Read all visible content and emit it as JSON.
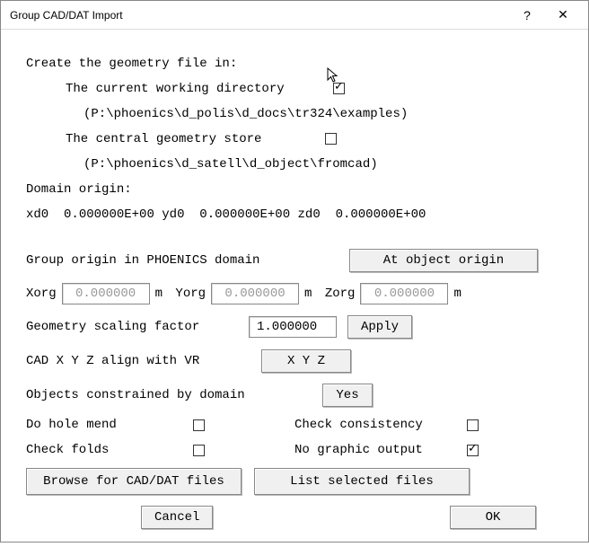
{
  "window": {
    "title": "Group CAD/DAT Import"
  },
  "create_label": "Create the geometry file in:",
  "opt_cwd_label": "The current working directory",
  "opt_cwd_checked": true,
  "opt_cwd_path": "(P:\\phoenics\\d_polis\\d_docs\\tr324\\examples)",
  "opt_store_label": "The central geometry store",
  "opt_store_checked": false,
  "opt_store_path": "(P:\\phoenics\\d_satell\\d_object\\fromcad)",
  "domain_origin_label": "Domain origin:",
  "domain_origin": {
    "xd0_label": "xd0",
    "xd0_val": "0.000000E+00",
    "yd0_label": "yd0",
    "yd0_val": "0.000000E+00",
    "zd0_label": "zd0",
    "zd0_val": "0.000000E+00"
  },
  "group_origin_label": "Group origin in PHOENICS domain",
  "at_origin_btn": "At object origin",
  "origin": {
    "x_label": "Xorg",
    "x_val": "0.000000",
    "x_unit": "m",
    "y_label": "Yorg",
    "y_val": "0.000000",
    "y_unit": "m",
    "z_label": "Zorg",
    "z_val": "0.000000",
    "z_unit": "m"
  },
  "scale_label": "Geometry scaling factor",
  "scale_val": "1.000000",
  "apply_btn": "Apply",
  "align_label": "CAD X Y Z align with VR",
  "align_btn": "X Y Z",
  "constrain_label": "Objects constrained by domain",
  "constrain_btn": "Yes",
  "hole_mend_label": "Do hole mend",
  "hole_mend_checked": false,
  "check_consistency_label": "Check consistency",
  "check_consistency_checked": false,
  "check_folds_label": "Check folds",
  "check_folds_checked": false,
  "no_graphic_label": "No graphic output",
  "no_graphic_checked": true,
  "browse_btn": "Browse for CAD/DAT files",
  "list_btn": "List selected files",
  "cancel_btn": "Cancel",
  "ok_btn": "OK"
}
